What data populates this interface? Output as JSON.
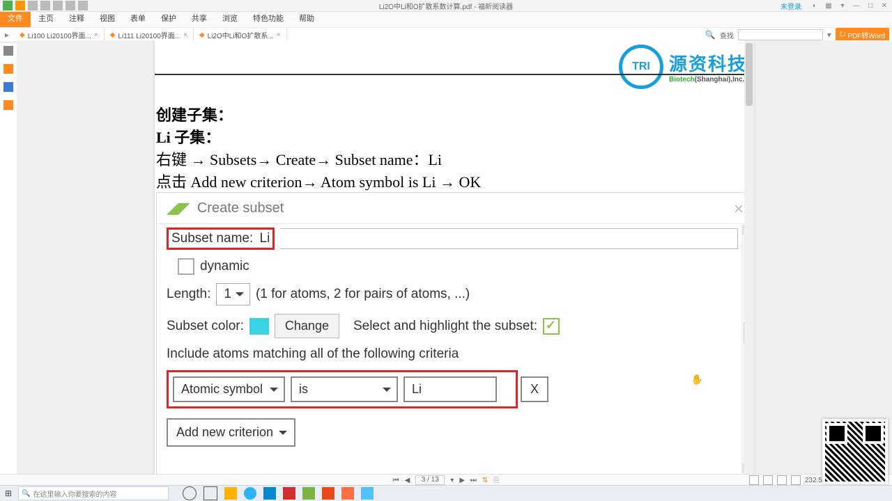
{
  "titlebar": {
    "doc_title": "Li2O中Li和O扩散系数计算.pdf - 福昕阅读器",
    "login": "未登录"
  },
  "menubar": {
    "tabs": [
      "文件",
      "主页",
      "注释",
      "视图",
      "表单",
      "保护",
      "共享",
      "浏览",
      "特色功能",
      "帮助"
    ]
  },
  "ribbon_right": {
    "find_label": "查找",
    "pdf_btn": "PDF转Word"
  },
  "doctabs": {
    "tabs": [
      {
        "label": "Li100 Li20100界面..."
      },
      {
        "label": "Li111 Li20100界面..."
      },
      {
        "label": "Li2O中Li和O扩散系..."
      }
    ]
  },
  "logo": {
    "cn": "源资科技",
    "en_g": "Biotech",
    "en_r": "(Shanghai),Inc.",
    "circ": "TRI"
  },
  "document": {
    "l1": "创建子集：",
    "l2": "Li 子集：",
    "l3_pre": "右键 ",
    "l3_a": "→",
    "l3_s1": " Subsets",
    "l3_s2": " Create",
    "l3_s3": " Subset name：Li",
    "l4_pre": "点击 Add new criterion",
    "l4_a": "→",
    "l4_s1": " Atom symbol is Li ",
    "l4_s2": " OK"
  },
  "embed": {
    "title": "Create subset",
    "subset_name_label": "Subset name:",
    "subset_name_value": "Li",
    "dynamic_label": "dynamic",
    "length_label": "Length:",
    "length_value": "1",
    "length_hint": "(1 for atoms, 2 for pairs of atoms, ...)",
    "color_label": "Subset color:",
    "change_btn": "Change",
    "select_label": "Select and highlight the subset:",
    "include_label": "Include atoms matching all of the following criteria",
    "crit_field": "Atomic symbol",
    "crit_op": "is",
    "crit_val": "Li",
    "crit_x": "X",
    "add_crit": "Add new criterion"
  },
  "statusbar": {
    "page": "3 / 13",
    "zoom": "232.53%"
  },
  "taskbar": {
    "search_placeholder": "在这里输入你要搜索的内容"
  }
}
